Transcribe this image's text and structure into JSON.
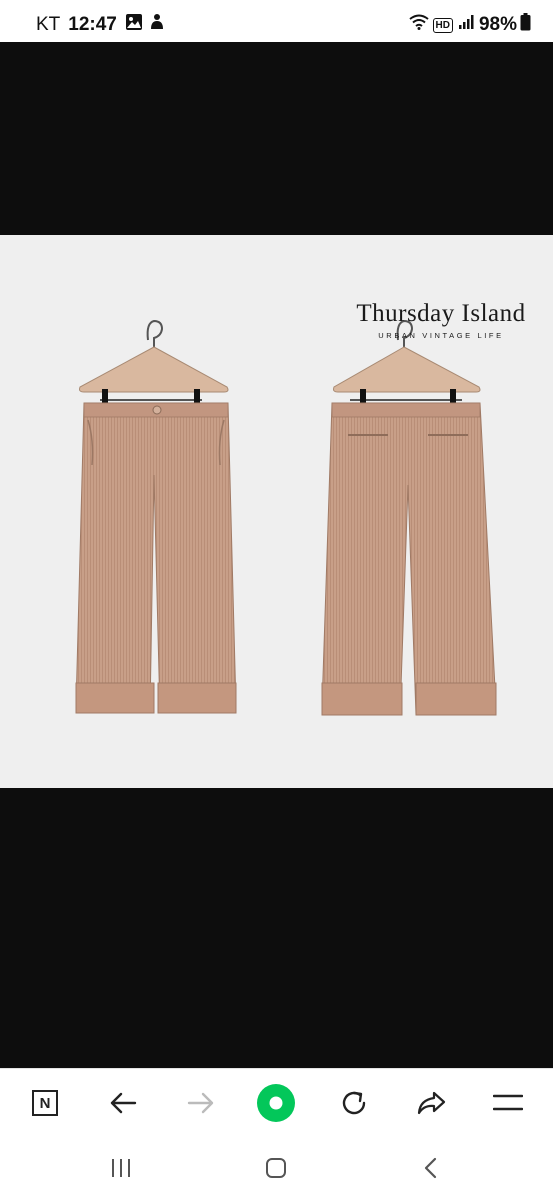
{
  "status_bar": {
    "carrier": "KT",
    "time": "12:47",
    "network_badge": "HD",
    "battery": "98%",
    "icons": [
      "gallery-icon",
      "notification-icon",
      "wifi-icon",
      "signal-icon",
      "battery-icon"
    ]
  },
  "image_viewer": {
    "brand_name": "Thursday Island",
    "brand_tagline": "URBAN VINTAGE LIFE",
    "product_color": "#c89f88",
    "background_color": "#efefef"
  },
  "browser_toolbar": {
    "home_label": "N",
    "buttons": [
      "naver-home-icon",
      "back-arrow-icon",
      "forward-arrow-icon",
      "green-dot-icon",
      "refresh-icon",
      "share-icon",
      "menu-icon"
    ],
    "accent_color": "#03c75a"
  },
  "system_nav": {
    "buttons": [
      "recent-apps-icon",
      "home-icon",
      "back-icon"
    ]
  }
}
